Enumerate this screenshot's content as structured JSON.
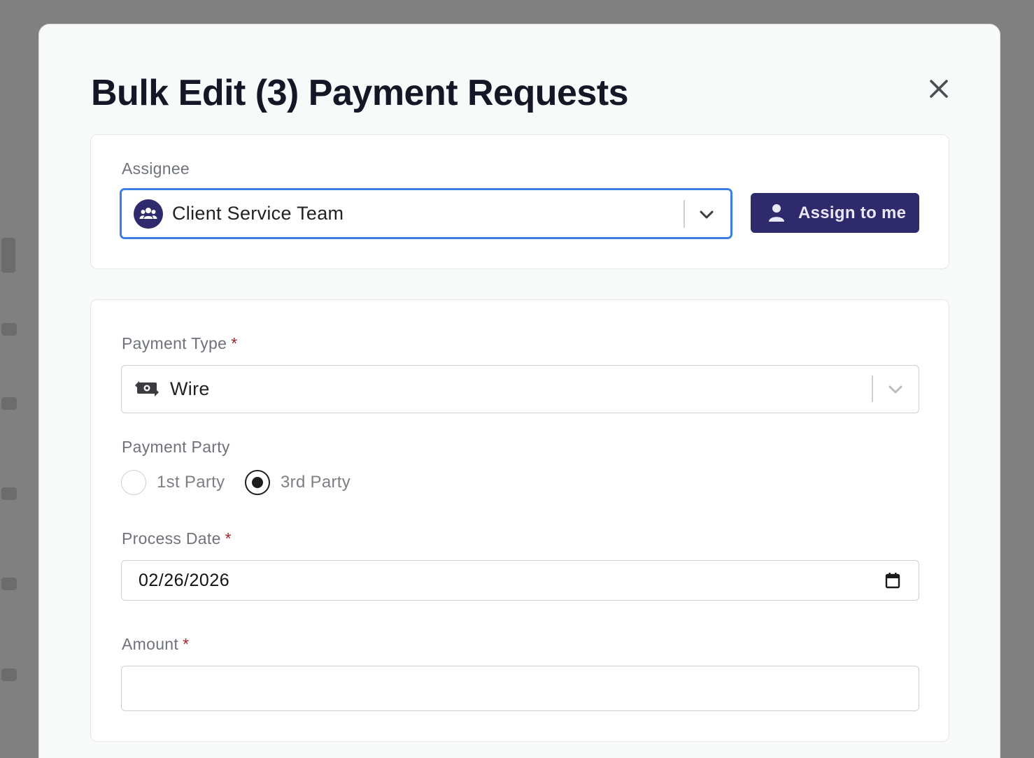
{
  "modal": {
    "title": "Bulk Edit (3) Payment Requests"
  },
  "assignee": {
    "label": "Assignee",
    "selected": "Client Service Team",
    "selected_icon": "team-icon",
    "assign_button_label": "Assign to me",
    "assign_button_icon": "user-icon"
  },
  "payment_type": {
    "label": "Payment Type",
    "required_mark": "*",
    "selected": "Wire",
    "selected_icon": "wire-transfer-icon"
  },
  "payment_party": {
    "label": "Payment Party",
    "options": [
      {
        "label": "1st Party",
        "checked": false
      },
      {
        "label": "3rd Party",
        "checked": true
      }
    ]
  },
  "process_date": {
    "label": "Process Date",
    "required_mark": "*",
    "value": "02/26/2026"
  },
  "amount": {
    "label": "Amount",
    "required_mark": "*",
    "value": ""
  },
  "colors": {
    "brand": "#2e2a6b",
    "focus_border": "#3d7ee3",
    "required": "#a0262b"
  }
}
